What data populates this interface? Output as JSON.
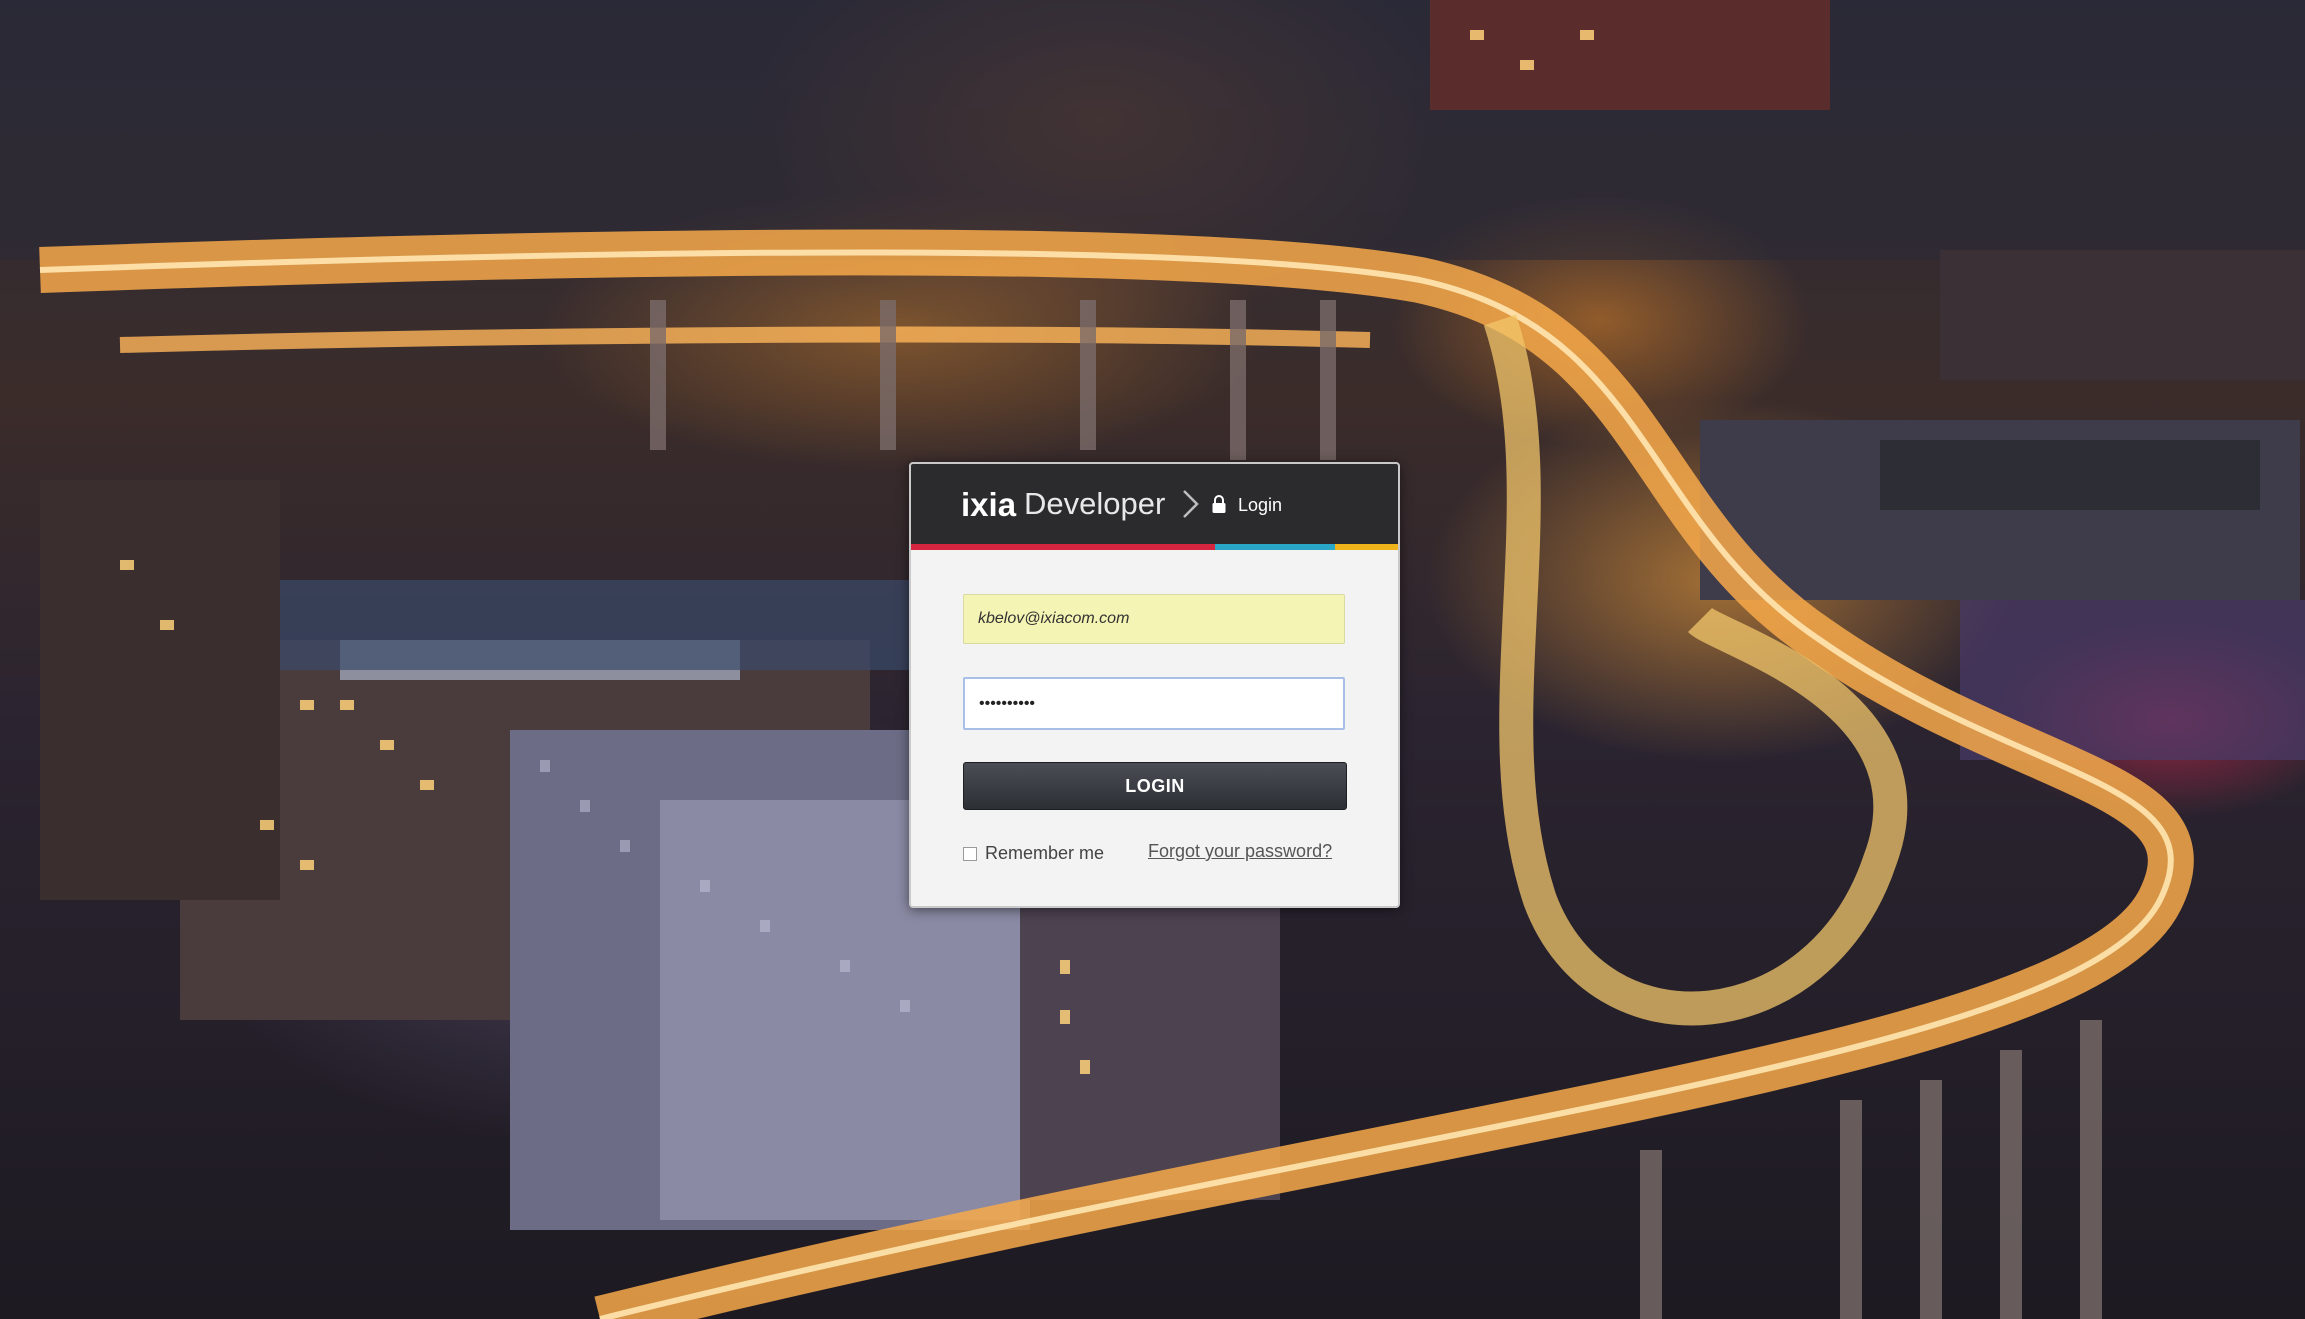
{
  "background": {
    "description_icon": "city-night-highway-photo"
  },
  "header": {
    "brand": "ixia",
    "product": "Developer",
    "breadcrumb_separator_icon": "chevron-right-icon",
    "lock_icon": "lock-icon",
    "breadcrumb_current": "Login"
  },
  "colors": {
    "header_bg": "#2b2b2d",
    "stripe": [
      "#d6263f",
      "#d6263f",
      "#2aa7c7",
      "#f0b41b"
    ],
    "email_bg": "#f4f4b4",
    "button_bg": "#2c2f34"
  },
  "form": {
    "email_value": "kbelov@ixiacom.com",
    "password_value": "••••••••••",
    "login_label": "LOGIN",
    "remember_label": "Remember me",
    "remember_checked": false,
    "forgot_label": "Forgot your password?"
  }
}
